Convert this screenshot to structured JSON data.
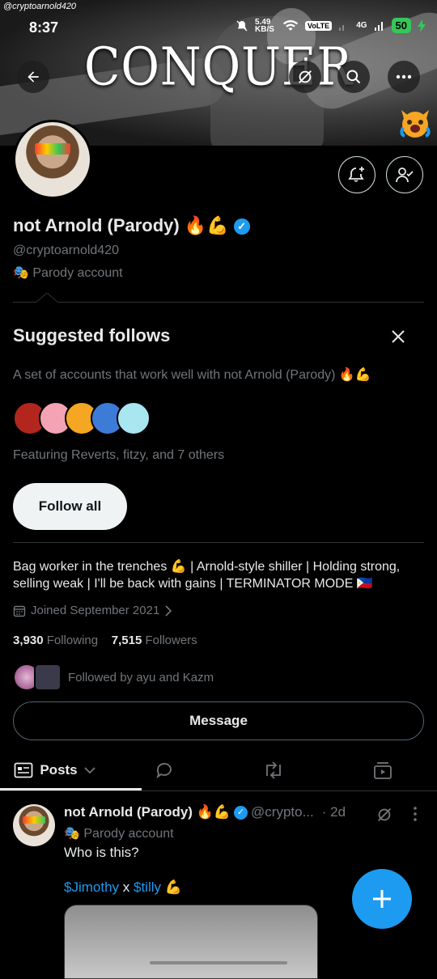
{
  "status_bar": {
    "watermark": "@cryptoarnold420",
    "time": "8:37",
    "net_speed": "5.49 KB/S",
    "volte": "VoLTE",
    "network": "4G",
    "battery": "50"
  },
  "banner": {
    "text": "CONQUER"
  },
  "profile": {
    "name": "not Arnold (Parody) 🔥💪",
    "handle": "@cryptoarnold420",
    "parody_label": "Parody account",
    "bio": "Bag worker in the trenches 💪 | Arnold-style shiller | Holding strong, selling weak | I'll be back with gains | TERMINATOR MODE 🇵🇭",
    "joined": "Joined September 2021",
    "following_count": "3,930",
    "following_label": "Following",
    "followers_count": "7,515",
    "followers_label": "Followers",
    "followed_by": "Followed by ayu and Kazm",
    "message_label": "Message"
  },
  "suggested": {
    "title": "Suggested follows",
    "description": "A set of accounts that work well with not Arnold (Parody) 🔥💪",
    "featuring": "Featuring Reverts, fitzy, and 7 others",
    "follow_all_label": "Follow all",
    "avatar_colors": [
      "#b3261e",
      "#f4a3b4",
      "#f5a623",
      "#3d7bd8",
      "#a8e6f0"
    ]
  },
  "tabs": [
    {
      "label": "Posts",
      "icon": "posts-icon"
    },
    {
      "label": "",
      "icon": "replies-icon"
    },
    {
      "label": "",
      "icon": "reposts-icon"
    },
    {
      "label": "",
      "icon": "media-icon"
    }
  ],
  "post": {
    "author": "not Arnold (Parody) 🔥💪",
    "handle": "@crypto...",
    "time": "· 2d",
    "parody_label": "Parody account",
    "text": "Who is this?",
    "tag1": "$Jimothy",
    "tag_sep": " x ",
    "tag2": "$tilly",
    "tag_emoji": " 💪"
  },
  "colors": {
    "accent": "#1d9bf0",
    "background": "#000000",
    "secondary_text": "#71767b"
  }
}
